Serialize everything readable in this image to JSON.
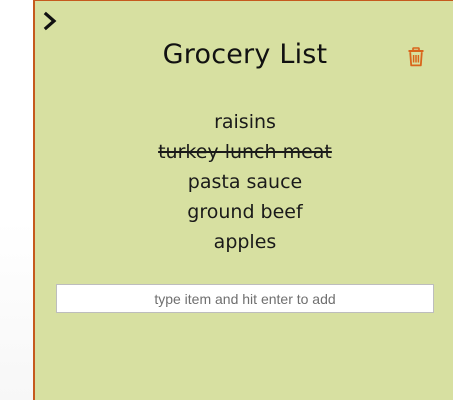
{
  "list": {
    "title": "Grocery List",
    "items": [
      {
        "label": "raisins",
        "done": false
      },
      {
        "label": "turkey lunch meat",
        "done": true
      },
      {
        "label": "pasta sauce",
        "done": false
      },
      {
        "label": "ground beef",
        "done": false
      },
      {
        "label": "apples",
        "done": false
      }
    ],
    "input_placeholder": "type item and hit enter to add",
    "input_value": ""
  },
  "icons": {
    "toggle": "chevron-right-icon",
    "delete": "trash-icon"
  },
  "colors": {
    "panel_bg": "#d7e0a1",
    "border": "#c55a1e",
    "trash": "#d9651b"
  }
}
